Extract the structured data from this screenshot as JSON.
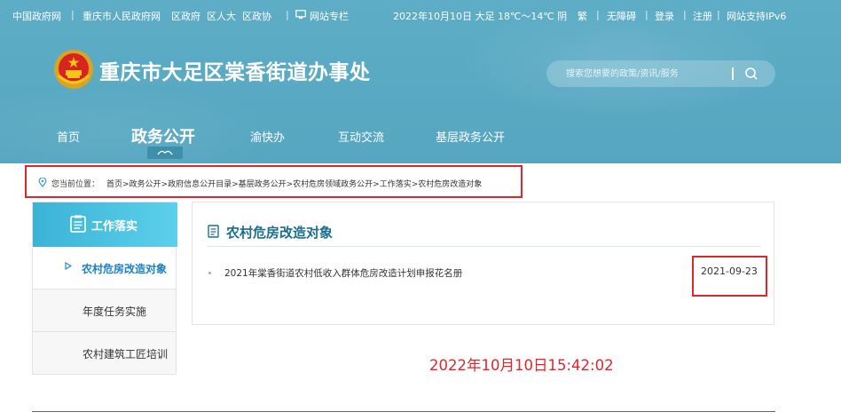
{
  "topbar": {
    "left_links": [
      "中国政府网",
      "重庆市人民政府网",
      "区政府",
      "区人大",
      "区政协",
      "网站专栏"
    ],
    "date_weather": "2022年10月10日  大足 18℃～14℃ 阴",
    "right_links": [
      "繁",
      "无障碍",
      "登录",
      "注册",
      "网站支持IPv6"
    ]
  },
  "site": {
    "title": "重庆市大足区棠香街道办事处"
  },
  "search": {
    "placeholder": "搜索您想要的政策/资讯/服务"
  },
  "nav": {
    "items": [
      "首页",
      "政务公开",
      "渝快办",
      "互动交流",
      "基层政务公开"
    ],
    "active_index": 1
  },
  "breadcrumb": {
    "label": "您当前位置：",
    "trail": "首页>政务公开>政府信息公开目录>基层政务公开>农村危房领域政务公开>工作落实>农村危房改造对象"
  },
  "sidebar": {
    "heading": "工作落实",
    "items": [
      "农村危房改造对象",
      "年度任务实施",
      "农村建筑工匠培训"
    ],
    "active_index": 0
  },
  "panel": {
    "title": "农村危房改造对象",
    "articles": [
      {
        "title": "2021年棠香街道农村低收入群体危房改造计划申报花名册",
        "date": "2021-09-23"
      }
    ]
  },
  "capture_time": "2022年10月10日15:42:02",
  "colors": {
    "header": "#5aa9c4",
    "accent": "#1a80c8",
    "highlight_red": "#e0262d",
    "sidebar_head": "#3bb3d6"
  }
}
